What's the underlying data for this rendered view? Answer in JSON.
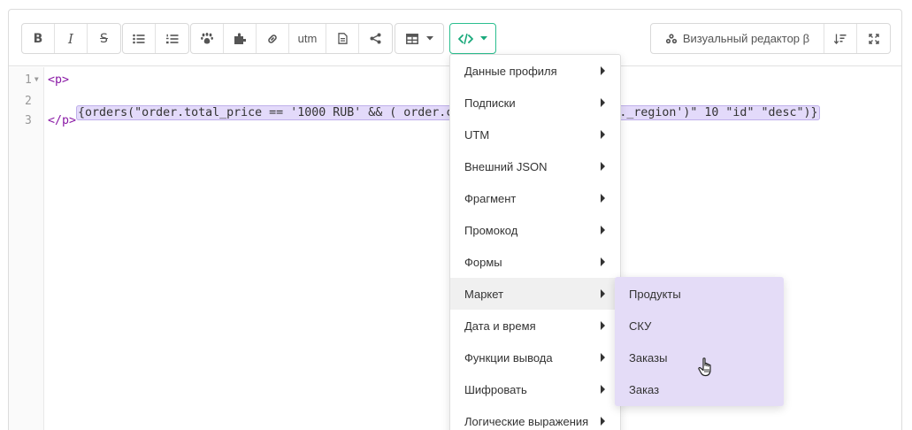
{
  "toolbar": {
    "bold_label": "B",
    "italic_label": "I",
    "strike_label": "S",
    "utm_label": "utm",
    "visual_editor_label": "Визуальный редактор β",
    "icons": [
      "bold-icon",
      "italic-icon",
      "strikethrough-icon",
      "bullet-list-icon",
      "numbered-list-icon",
      "paw-icon",
      "puzzle-icon",
      "link-icon",
      "utm-icon",
      "document-icon",
      "share-icon",
      "table-icon",
      "code-icon",
      "visual-editor-icon",
      "sort-icon",
      "fullscreen-icon"
    ]
  },
  "editor": {
    "line_numbers": [
      "1",
      "2",
      "3"
    ],
    "line1_tag": "<p>",
    "line2_left": "{orders(\"order.total_price == '1000 RUB' && ( order.cu",
    "line2_right": "ead._region')\" 10 \"id\" \"desc\")}",
    "line3_tag": "</p>"
  },
  "menu": {
    "items": [
      "Данные профиля",
      "Подписки",
      "UTM",
      "Внешний JSON",
      "Фрагмент",
      "Промокод",
      "Формы",
      "Маркет",
      "Дата и время",
      "Функции вывода",
      "Шифровать",
      "Логические выражения"
    ],
    "active_item": "Маркет"
  },
  "submenu": {
    "items": [
      "Продукты",
      "СКУ",
      "Заказы",
      "Заказ"
    ],
    "hovered_item": "Заказы"
  },
  "colors": {
    "accent_green": "#19a97b",
    "highlight": "#e3dafa",
    "submenu_bg": "#e4dcf7",
    "tag_color": "#8a1aa6"
  }
}
